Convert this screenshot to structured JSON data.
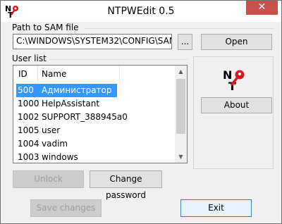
{
  "window": {
    "title": "NTPWEdit 0.5",
    "close_glyph": "✕"
  },
  "sam": {
    "label": "Path to SAM file",
    "path": "C:\\WINDOWS\\SYSTEM32\\CONFIG\\SAM",
    "browse_label": "...",
    "open_label": "Open"
  },
  "userlist": {
    "label": "User list",
    "columns": {
      "id": "ID",
      "name": "Name"
    },
    "rows": [
      {
        "id": "500",
        "name": "Администратор",
        "selected": true
      },
      {
        "id": "1000",
        "name": "HelpAssistant"
      },
      {
        "id": "1002",
        "name": "SUPPORT_388945a0"
      },
      {
        "id": "1005",
        "name": "user"
      },
      {
        "id": "1004",
        "name": "vadim"
      },
      {
        "id": "1003",
        "name": "windows"
      }
    ]
  },
  "actions": {
    "unlock_label": "Unlock",
    "change_password_label": "Change password",
    "about_label": "About",
    "save_label": "Save changes",
    "exit_label": "Exit"
  },
  "icons": {
    "app": "ntpwedit-key-logo-icon",
    "close": "close-icon"
  },
  "colors": {
    "selection": "#3399ff",
    "close_button": "#c7504b",
    "logo_red": "#d71920"
  }
}
